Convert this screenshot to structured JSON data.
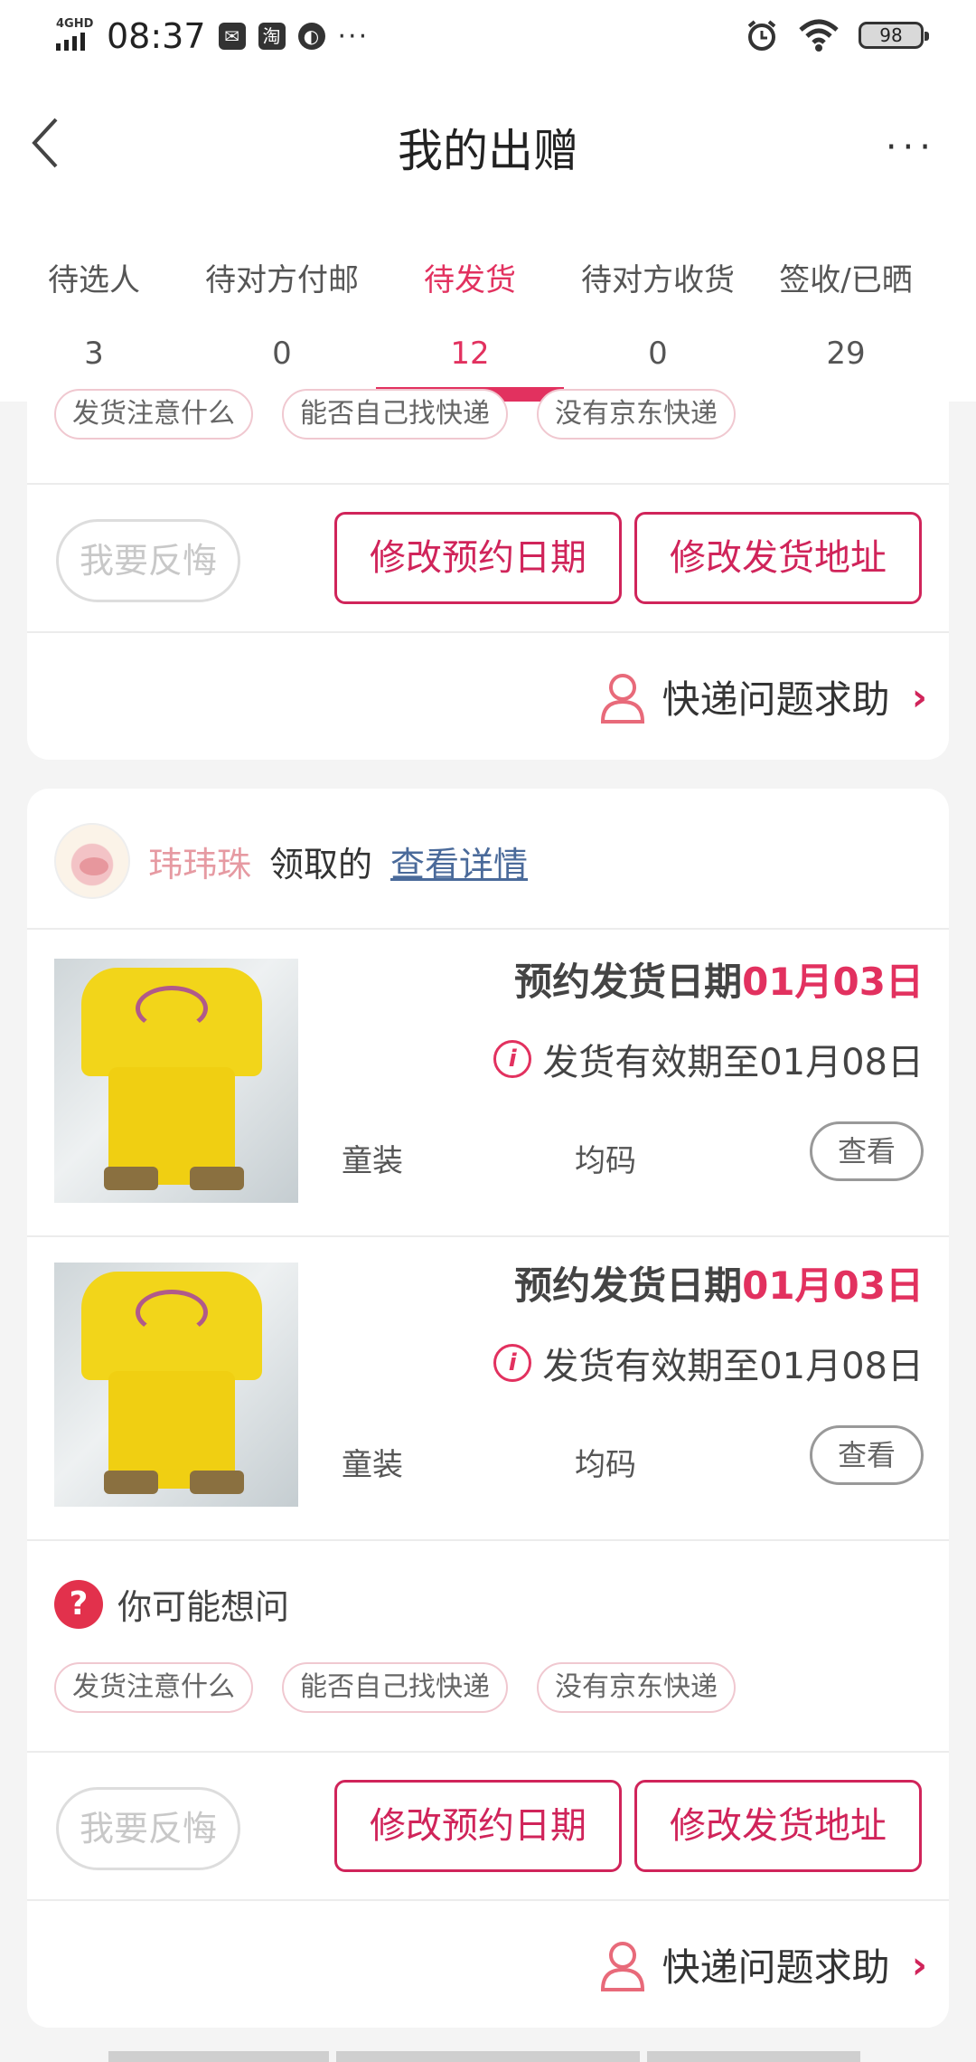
{
  "status_bar": {
    "network": "4GHD",
    "time": "08:37",
    "battery": "98",
    "notif_taobao": "淘",
    "more": "···"
  },
  "header": {
    "title": "我的出赠",
    "more": "···"
  },
  "tabs": [
    {
      "label": "待选人",
      "count": "3"
    },
    {
      "label": "待对方付邮",
      "count": "0"
    },
    {
      "label": "待发货",
      "count": "12"
    },
    {
      "label": "待对方收货",
      "count": "0"
    },
    {
      "label": "签收/已晒",
      "count": "29"
    }
  ],
  "active_tab": "待发货",
  "colors": {
    "accent": "#e2315f",
    "button": "#d0245a"
  },
  "card1": {
    "chips": [
      "发货注意什么",
      "能否自己找快递",
      "没有京东快递"
    ],
    "regret_label": "我要反悔",
    "change_date_label": "修改预约日期",
    "change_address_label": "修改发货地址",
    "help_label": "快递问题求助"
  },
  "card2": {
    "giver_name": "玮玮珠",
    "received_text": "领取的",
    "details_link": "查看详情",
    "items": [
      {
        "schedule_label": "预约发货日期",
        "schedule_date": "01月03日",
        "valid_text": "发货有效期至01月08日",
        "category": "童装",
        "size": "均码",
        "view_label": "查看"
      },
      {
        "schedule_label": "预约发货日期",
        "schedule_date": "01月03日",
        "valid_text": "发货有效期至01月08日",
        "category": "童装",
        "size": "均码",
        "view_label": "查看"
      }
    ],
    "faq_title": "你可能想问",
    "chips": [
      "发货注意什么",
      "能否自己找快递",
      "没有京东快递"
    ],
    "regret_label": "我要反悔",
    "change_date_label": "修改预约日期",
    "change_address_label": "修改发货地址",
    "help_label": "快递问题求助"
  }
}
